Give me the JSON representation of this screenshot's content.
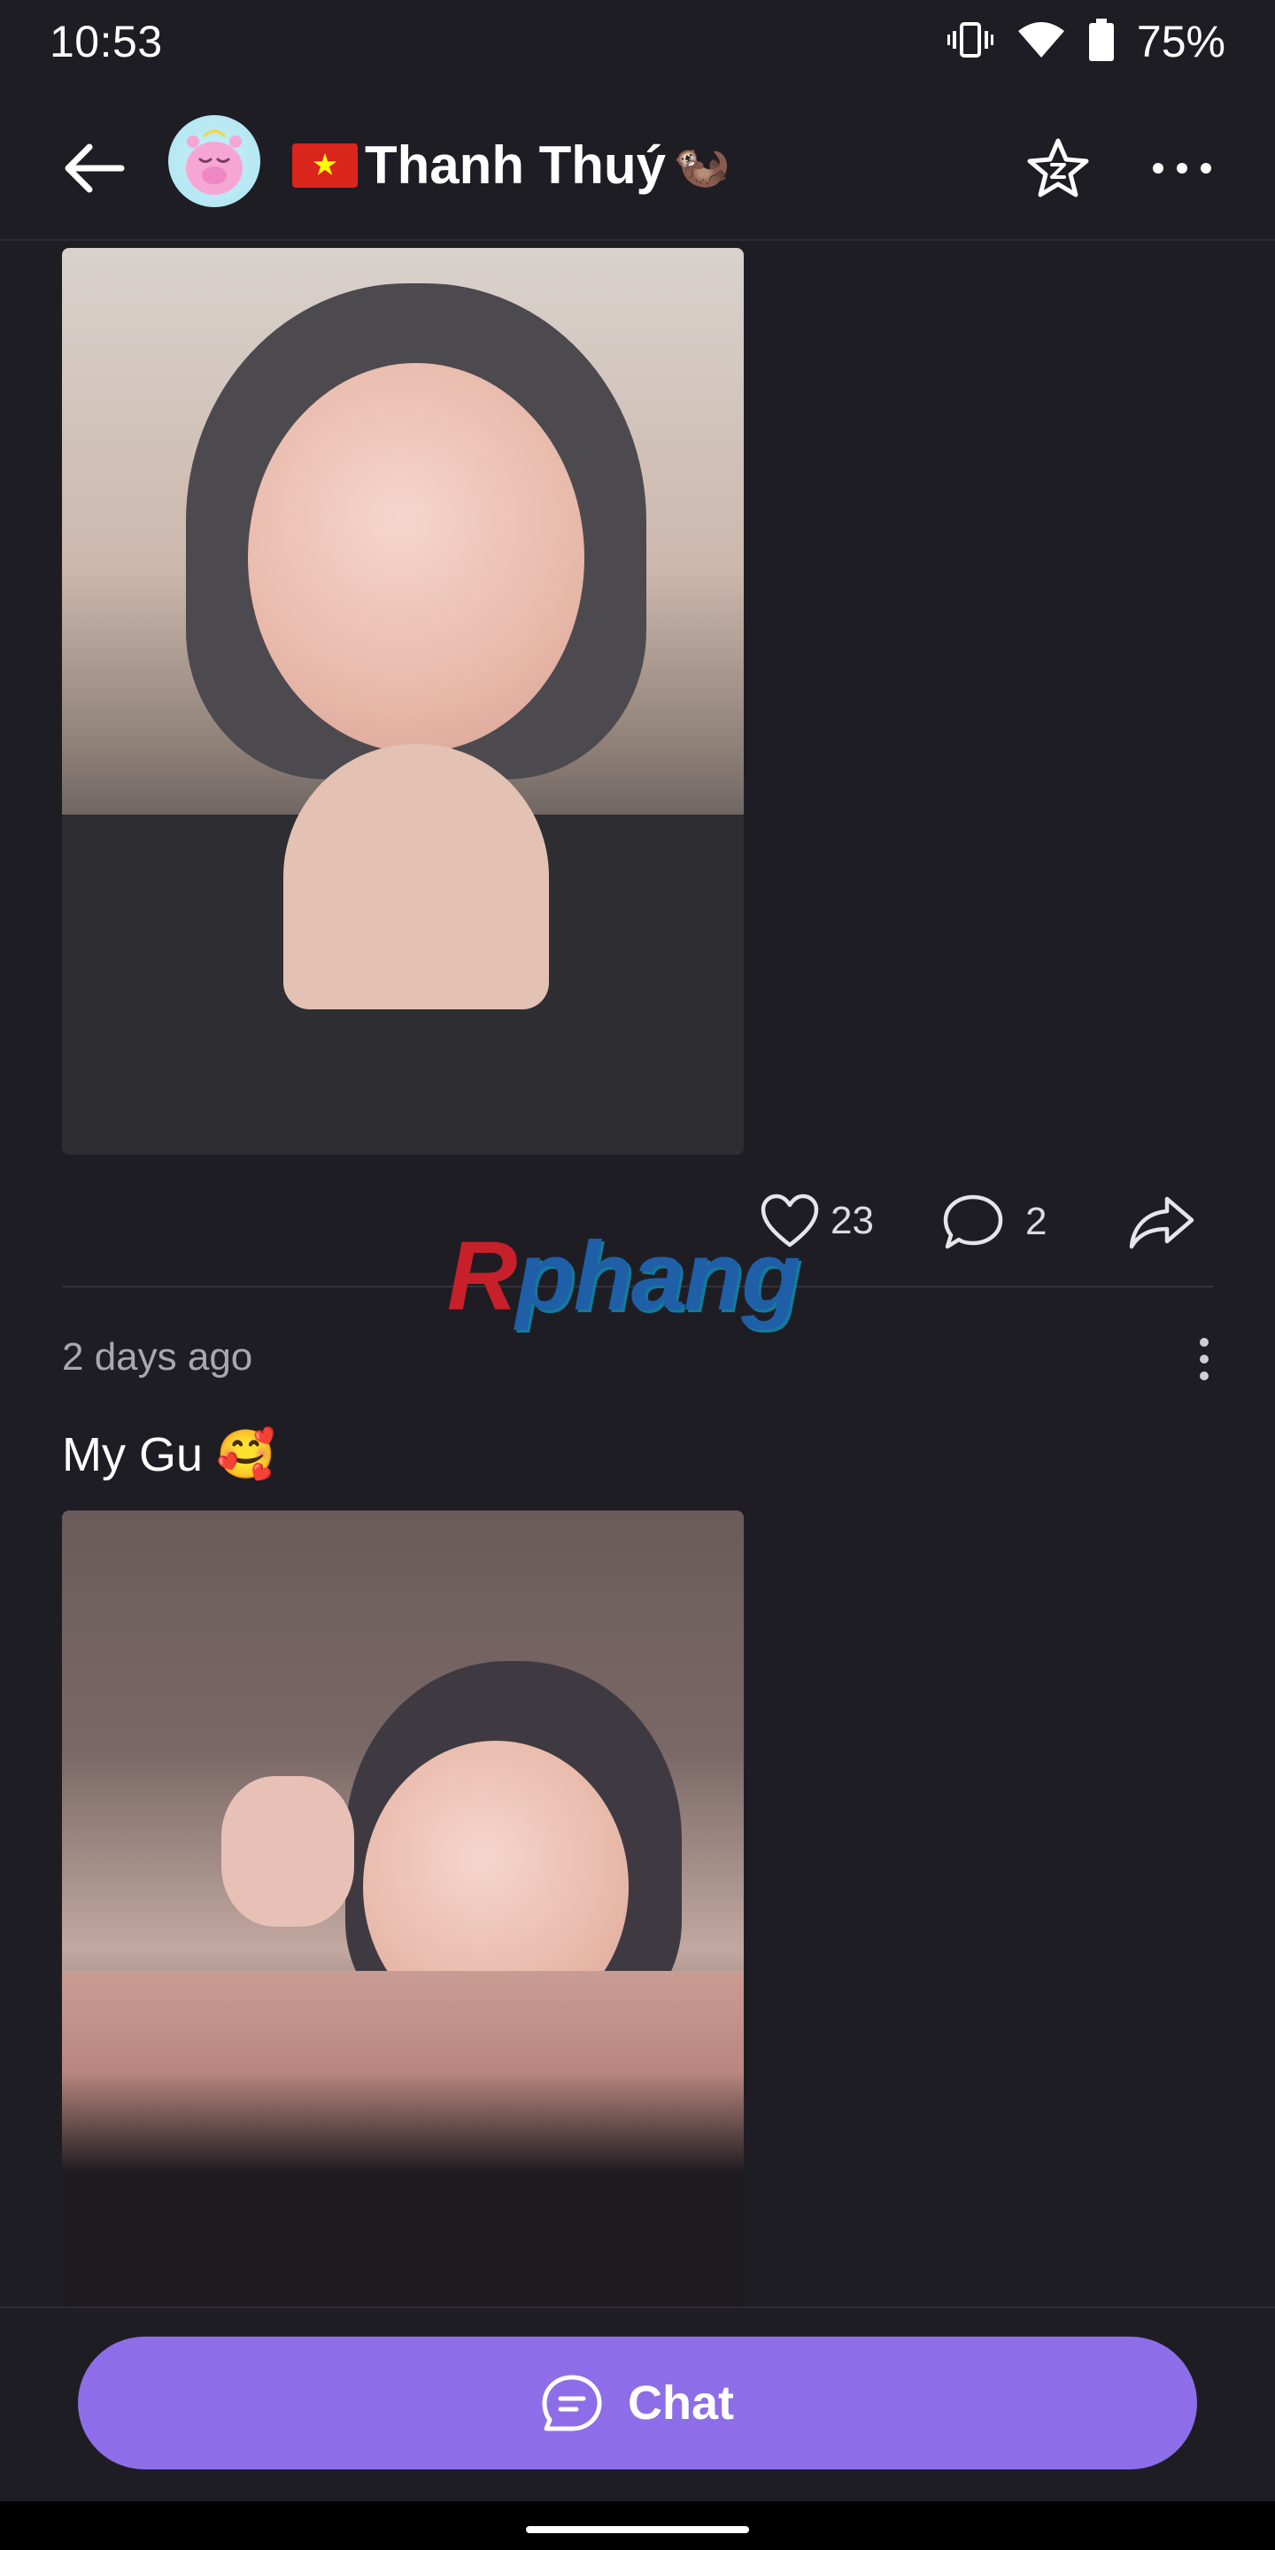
{
  "status_bar": {
    "time": "10:53",
    "battery": "75%",
    "icons": [
      "vibrate-icon",
      "wifi-icon",
      "battery-icon"
    ]
  },
  "header": {
    "back_icon": "arrow-left-icon",
    "profile_name": "Thanh Thuý",
    "flag_emoji": "vietnam-flag",
    "trailing_emoji": "🦦",
    "favorite_icon": "star-z-icon",
    "more_icon": "more-horizontal-icon"
  },
  "post_1": {
    "likes": "23",
    "comments": "2",
    "share_icon": "share-icon"
  },
  "watermark": {
    "first_letter": "R",
    "rest": "phang"
  },
  "post_2": {
    "time": "2 days ago",
    "caption": "My Gu 🥰"
  },
  "bottom": {
    "chat_label": "Chat",
    "chat_icon": "chat-bubble-icon"
  },
  "colors": {
    "background": "#1f1d24",
    "accent": "#8d6ee8"
  }
}
